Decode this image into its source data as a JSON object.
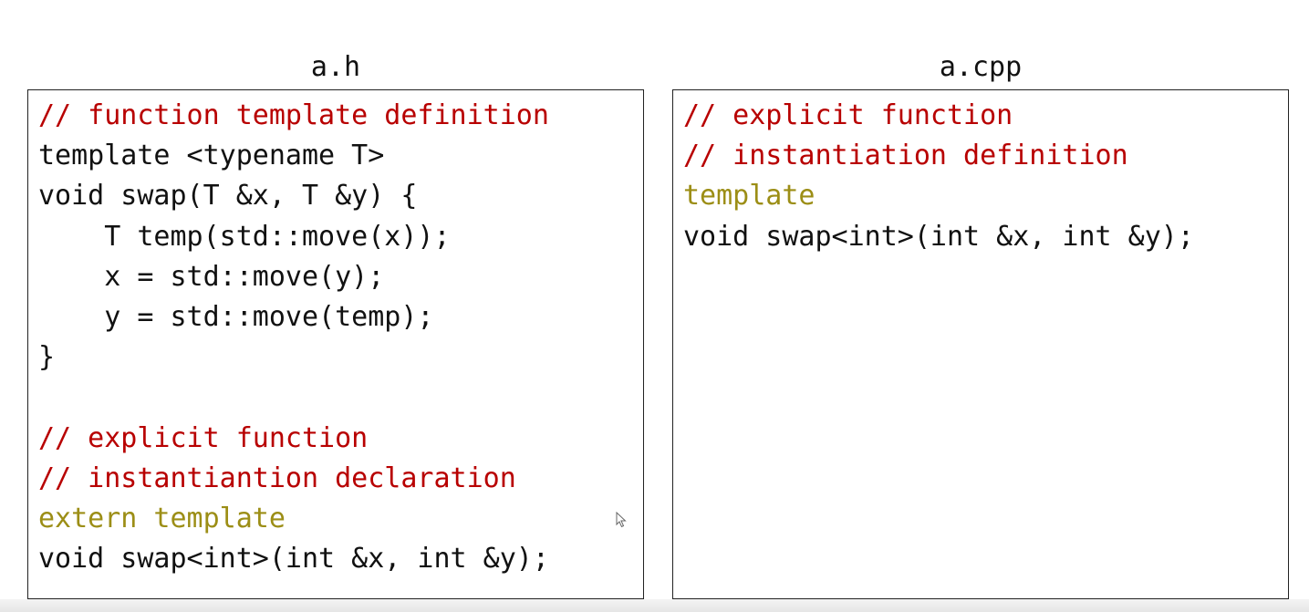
{
  "left_panel": {
    "title": "a.h",
    "lines": [
      {
        "text": "// function template definition",
        "kind": "comment"
      },
      {
        "text": "template <typename T>",
        "kind": "code"
      },
      {
        "text": "void swap(T &x, T &y) {",
        "kind": "code"
      },
      {
        "text": "    T temp(std::move(x));",
        "kind": "code"
      },
      {
        "text": "    x = std::move(y);",
        "kind": "code"
      },
      {
        "text": "    y = std::move(temp);",
        "kind": "code"
      },
      {
        "text": "}",
        "kind": "code"
      },
      {
        "text": "",
        "kind": "code"
      },
      {
        "text": "// explicit function",
        "kind": "comment"
      },
      {
        "text": "// instantiantion declaration",
        "kind": "comment"
      },
      {
        "text": "extern template",
        "kind": "keyword"
      },
      {
        "text": "void swap<int>(int &x, int &y);",
        "kind": "code"
      }
    ]
  },
  "right_panel": {
    "title": "a.cpp",
    "lines": [
      {
        "text": "// explicit function",
        "kind": "comment"
      },
      {
        "text": "// instantiation definition",
        "kind": "comment"
      },
      {
        "text": "template",
        "kind": "keyword"
      },
      {
        "text": "void swap<int>(int &x, int &y);",
        "kind": "code"
      }
    ]
  },
  "colors": {
    "comment": "#b80000",
    "keyword": "#9c8e16",
    "code": "#111111",
    "border": "#222222"
  },
  "icons": {
    "cursor": "mouse-pointer-icon"
  }
}
